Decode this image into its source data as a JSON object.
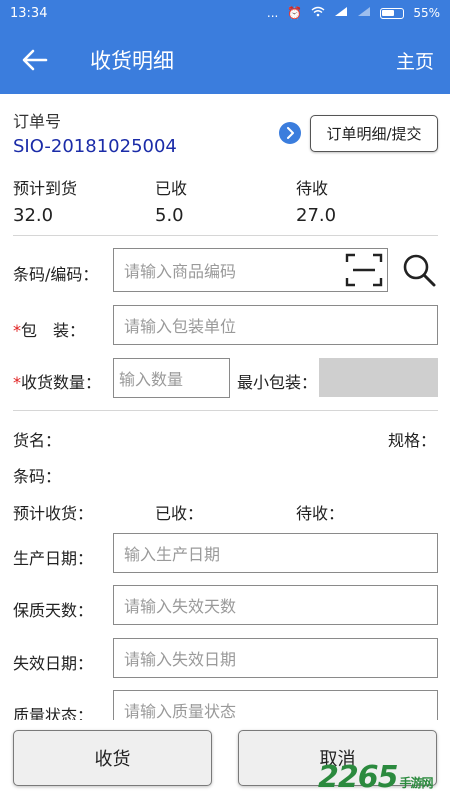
{
  "status": {
    "time": "13:34",
    "dots": "...",
    "battery": "55%"
  },
  "appbar": {
    "title": "收货明细",
    "home": "主页"
  },
  "order": {
    "label": "订单号",
    "number": "SIO-20181025004",
    "detail_button": "订单明细/提交"
  },
  "stats": [
    {
      "label": "预计到货",
      "value": "32.0"
    },
    {
      "label": "已收",
      "value": "5.0"
    },
    {
      "label": "待收",
      "value": "27.0"
    }
  ],
  "form": {
    "barcode_label": "条码/编码：",
    "barcode_placeholder": "请输入商品编码",
    "pack_label_req": "*",
    "pack_label": "包　装：",
    "pack_placeholder": "请输入包装单位",
    "qty_label_req": "*",
    "qty_label": "收货数量：",
    "qty_placeholder": "输入数量",
    "minpack_label": "最小包装："
  },
  "goods": {
    "name_label": "货名：",
    "spec_label": "规格：",
    "barcode_label": "条码：",
    "expected_label": "预计收货：",
    "received_label": "已收：",
    "pending_label": "待收："
  },
  "details": [
    {
      "label": "生产日期：",
      "placeholder": "输入生产日期"
    },
    {
      "label": "保质天数：",
      "placeholder": "请输入失效天数"
    },
    {
      "label": "失效日期：",
      "placeholder": "请输入失效日期"
    },
    {
      "label": "质量状态：",
      "placeholder": "请输入质量状态"
    }
  ],
  "buttons": {
    "receive": "收货",
    "cancel": "取消"
  },
  "watermark": {
    "brand": "2265",
    "suffix": "手游网"
  }
}
